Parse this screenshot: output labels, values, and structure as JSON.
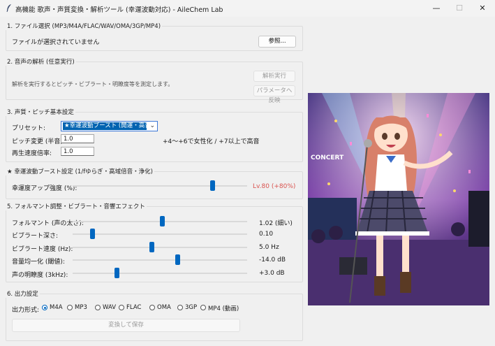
{
  "window": {
    "title": "高機能 歌声・声質変換・解析ツール (幸運波動対応) - AileChem Lab",
    "minimize_icon": "minimize-icon",
    "maximize_icon": "maximize-icon",
    "close_icon": "close-icon"
  },
  "file_select": {
    "group_title": "1. ファイル選択 (MP3/M4A/FLAC/WAV/OMA/3GP/MP4)",
    "status": "ファイルが選択されていません",
    "browse_label": "参照..."
  },
  "analysis": {
    "group_title": "2. 音声の解析 (任意実行)",
    "description": "解析を実行するとピッチ・ビブラート・明瞭度等を測定します。",
    "run_label": "解析実行",
    "apply_label": "パラメータへ反映"
  },
  "basic": {
    "group_title": "3. 声質・ピッチ基本設定",
    "preset_label": "プリセット:",
    "preset_value": "★幸運波動ブースト (開運・高音質)",
    "pitch_label": "ピッチ変更 (半音):",
    "pitch_value": "1.0",
    "pitch_hint": "+4～+6で女性化 / +7以上で高音",
    "speed_label": "再生速度倍率:",
    "speed_value": "1.0"
  },
  "luck": {
    "group_title": "★ 幸運波動ブースト設定 (1/fゆらぎ・高域倍音・浄化)",
    "strength_label": "幸運度アップ強度 (%):",
    "strength_value_text": "Lv.80 (+80%)",
    "strength_level": 0.8,
    "accent_color": "#d9534f"
  },
  "formant": {
    "group_title": "5. フォルマント調整・ビブラート・音響エフェクト",
    "sliders": [
      {
        "label": "フォルマント (声の太さ):",
        "value_text": "1.02 (細い)",
        "level": 0.51
      },
      {
        "label": "ビブラート深さ:",
        "value_text": "0.10",
        "level": 0.11
      },
      {
        "label": "ビブラート速度 (Hz):",
        "value_text": "5.0 Hz",
        "level": 0.45
      },
      {
        "label": "音量均一化 (閾値):",
        "value_text": "-14.0 dB",
        "level": 0.6
      },
      {
        "label": "声の明瞭度 (3kHz):",
        "value_text": "+3.0 dB",
        "level": 0.25
      }
    ]
  },
  "output": {
    "group_title": "6. 出力設定",
    "format_label": "出力形式:",
    "formats": [
      "M4A",
      "MP3",
      "WAV",
      "FLAC",
      "OMA",
      "3GP",
      "MP4 (動画)"
    ],
    "selected_format": "M4A",
    "save_label": "変換して保存"
  },
  "picture": {
    "stage_text": "CONCERT"
  },
  "colors": {
    "accent": "#0067c0",
    "selection": "#0063b1"
  }
}
